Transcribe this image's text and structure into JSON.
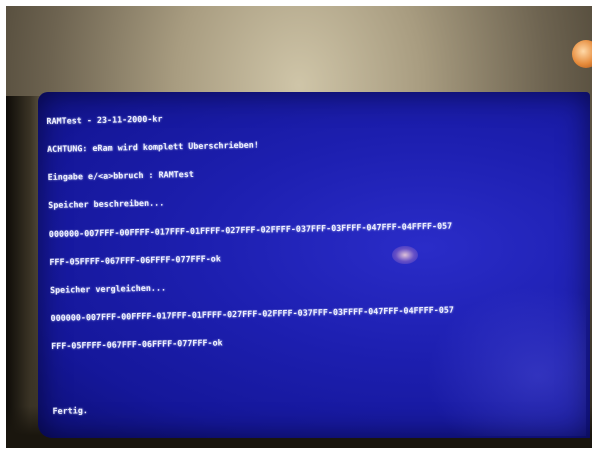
{
  "photo": {
    "subject": "crt-monitor-blue-screen",
    "screen_color": "#1d1fb0",
    "text_color": "#eef0ff"
  },
  "terminal": {
    "lines": [
      "RAMTest - 23-11-2000-kr",
      "ACHTUNG: eRam wird komplett Überschrieben!",
      "Eingabe e/<a>bbruch : RAMTest",
      "Speicher beschreiben...",
      "000000-007FFF-00FFFF-017FFF-01FFFF-027FFF-02FFFF-037FFF-03FFFF-047FFF-04FFFF-057",
      "FFF-05FFFF-067FFF-06FFFF-077FFF-ok",
      "Speicher vergleichen...",
      "000000-007FFF-00FFFF-017FFF-01FFFF-027FFF-02FFFF-037FFF-03FFFF-047FFF-04FFFF-057",
      "FFF-05FFFF-067FFF-06FFFF-077FFF-ok"
    ],
    "final": "Fertig."
  }
}
